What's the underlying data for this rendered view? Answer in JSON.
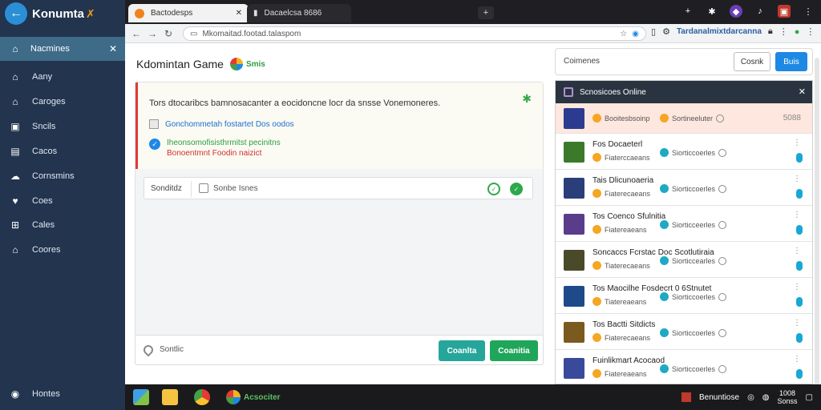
{
  "app": {
    "brand": "Konumta",
    "brand_mark": "✗"
  },
  "sidebar": {
    "active": "Nacmines",
    "items": [
      {
        "label": "Aany",
        "icon": "home-icon"
      },
      {
        "label": "Caroges",
        "icon": "home-icon"
      },
      {
        "label": "Sncils",
        "icon": "chat-icon"
      },
      {
        "label": "Cacos",
        "icon": "document-icon"
      },
      {
        "label": "Cornsmins",
        "icon": "share-icon"
      },
      {
        "label": "Coes",
        "icon": "heart-icon"
      },
      {
        "label": "Cales",
        "icon": "grid-icon"
      },
      {
        "label": "Coores",
        "icon": "house-icon"
      }
    ],
    "bottom": "Hontes"
  },
  "browser": {
    "tabs": [
      {
        "label": "Bactodesps"
      },
      {
        "label": "Dacaelcsa 8686"
      }
    ],
    "url": "Mkomaitad.footad.talaspom",
    "extension_link": "Tardanalmixtdarcanna"
  },
  "main": {
    "title": "Kdomintan Game",
    "title_badge": "Smis",
    "alert": {
      "title": "Tors dtocaribcs bamnosacanter a eocidoncne locr da snsse Vonemoneres.",
      "option1": "Gonchommetah fostartet Dos oodos",
      "option2_line1": "Iheonsomofisisthrmitst pecinitns",
      "option2_line2": "Bonoentmnt Foodin naizict"
    },
    "searchrow": {
      "label": "Sonditdz",
      "filter": "Sonbe Isnes"
    },
    "composer": {
      "placeholder": "Sontlic",
      "btn1": "Coanlta",
      "btn2": "Coanitia"
    }
  },
  "right": {
    "search_label": "Coimenes",
    "btn_outline": "Cosnk",
    "btn_primary": "Buis",
    "panel_title": "Scnosicoes Online",
    "rows": [
      {
        "title": "Booitesbsoinp",
        "sub": "Sortineeluter",
        "price": "5088",
        "highlight": true,
        "thumb": "#2c3b8f"
      },
      {
        "title": "Fos Docaeterl",
        "sub": "Fiaterccaeans",
        "sub2": "Siorticcoerles",
        "thumb": "#3b7a2a"
      },
      {
        "title": "Tais Dlicunoaeria",
        "sub": "Fiaterecaeans",
        "sub2": "Siorticcoerles",
        "thumb": "#2a3f7a"
      },
      {
        "title": "Tos Coenco Sfulnitia",
        "sub": "Fiatereaeans",
        "sub2": "Siorticceerles",
        "thumb": "#5a3d8a"
      },
      {
        "title": "Soncaccs Fcrstac Doc Scotlutiraia",
        "sub": "Tiaterecaeans",
        "sub2": "Siorticcearles",
        "thumb": "#4a4a2a"
      },
      {
        "title": "Tos Maocilhe Fosdecrt 0 6Stnutet",
        "sub": "Tiatereaeans",
        "sub2": "Siorticcoerles",
        "thumb": "#1f4a8a"
      },
      {
        "title": "Tos Bactti Sitdicts",
        "sub": "Fiaterecaeans",
        "sub2": "Siorticcoerles",
        "thumb": "#7a5a1f"
      },
      {
        "title": "Fuinlikmart Acocaod",
        "sub": "Fiatereaeans",
        "sub2": "Siorticcoerles",
        "thumb": "#3a4a9a"
      }
    ]
  },
  "taskbar": {
    "label": "Acsociter",
    "tray_text": "Benuntiose",
    "clock_time": "1008",
    "clock_date": "Sonss"
  }
}
